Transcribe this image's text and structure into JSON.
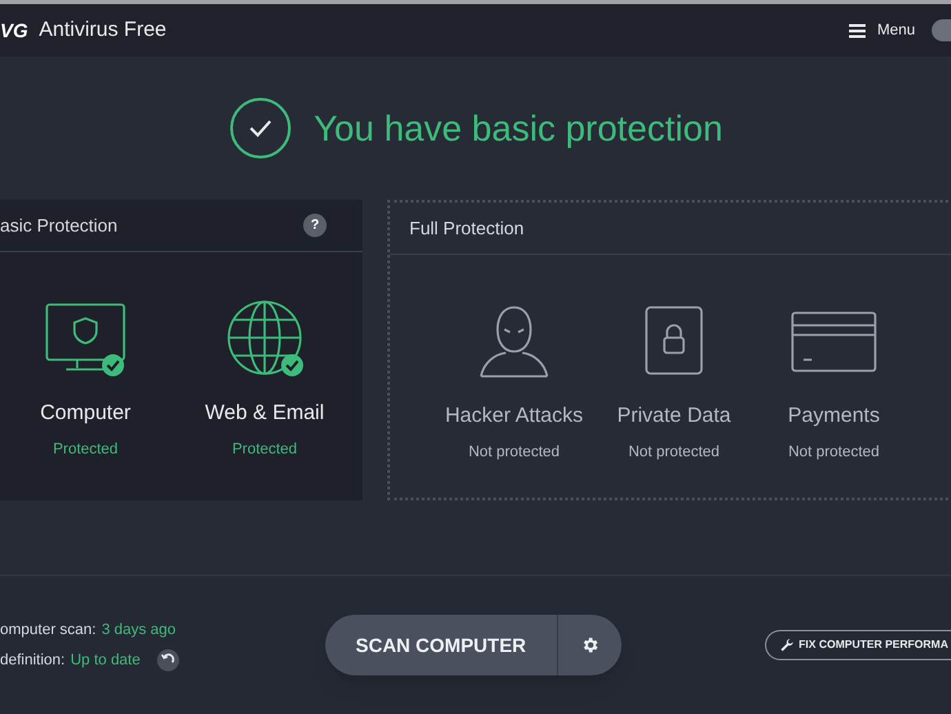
{
  "header": {
    "logo": "VG",
    "title": "Antivirus Free",
    "menu": "Menu"
  },
  "status": {
    "title": "You have basic protection",
    "protected": true
  },
  "panels": [
    {
      "title": "asic Protection",
      "kind": "basic",
      "help": "?",
      "items": [
        {
          "label": "Computer",
          "status": "Protected",
          "protected": true,
          "kind": "computer"
        },
        {
          "label": "Web & Email",
          "status": "Protected",
          "protected": true,
          "kind": "globe"
        }
      ]
    },
    {
      "title": "Full Protection",
      "kind": "full",
      "items": [
        {
          "label": "Hacker Attacks",
          "status": "Not protected",
          "protected": false,
          "kind": "person"
        },
        {
          "label": "Private Data",
          "status": "Not protected",
          "protected": false,
          "kind": "lock"
        },
        {
          "label": "Payments",
          "status": "Not protected",
          "protected": false,
          "kind": "card"
        }
      ]
    }
  ],
  "footer": {
    "scan_label": "omputer scan:",
    "scan_value": "3 days ago",
    "def_label": "definition:",
    "def_value": "Up to date",
    "scan_button": "SCAN COMPUTER",
    "fix_button": "FIX COMPUTER PERFORMA"
  }
}
